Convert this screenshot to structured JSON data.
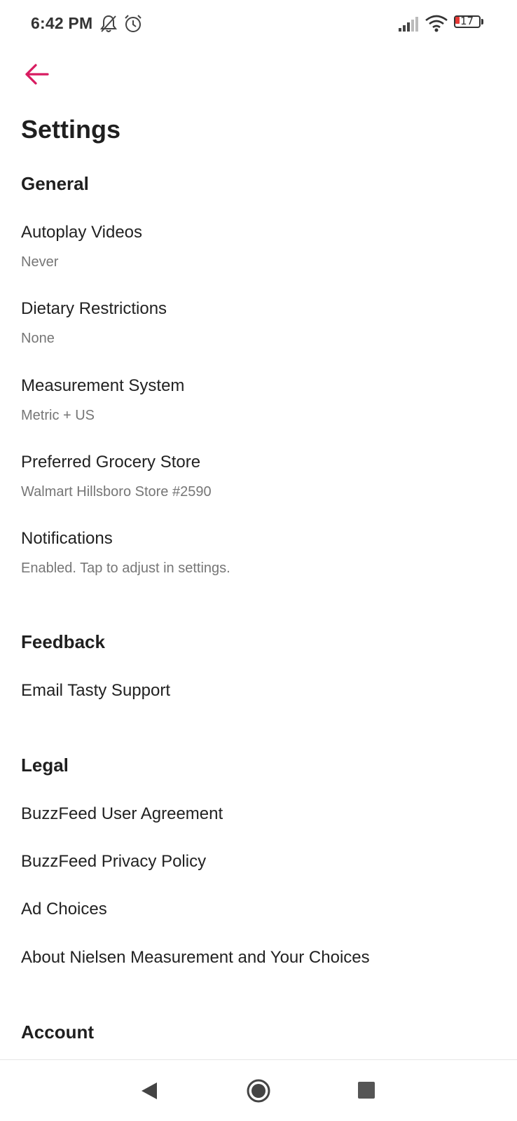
{
  "status_bar": {
    "time": "6:42 PM",
    "battery_level": "17",
    "icons": [
      "bell-muted-icon",
      "alarm-icon",
      "signal-icon",
      "wifi-icon",
      "battery-icon"
    ]
  },
  "header": {
    "back_icon": "arrow-left-icon",
    "title": "Settings"
  },
  "colors": {
    "accent": "#d81b60",
    "battery_low": "#e53935"
  },
  "sections": {
    "general": {
      "title": "General",
      "items": [
        {
          "label": "Autoplay Videos",
          "value": "Never"
        },
        {
          "label": "Dietary Restrictions",
          "value": "None"
        },
        {
          "label": "Measurement System",
          "value": "Metric + US"
        },
        {
          "label": "Preferred Grocery Store",
          "value": "Walmart Hillsboro Store #2590"
        },
        {
          "label": "Notifications",
          "value": "Enabled. Tap to adjust in settings."
        }
      ]
    },
    "feedback": {
      "title": "Feedback",
      "items": [
        {
          "label": "Email Tasty Support"
        }
      ]
    },
    "legal": {
      "title": "Legal",
      "items": [
        {
          "label": "BuzzFeed User Agreement"
        },
        {
          "label": "BuzzFeed Privacy Policy"
        },
        {
          "label": "Ad Choices"
        },
        {
          "label": "About Nielsen Measurement and Your Choices"
        }
      ]
    },
    "account": {
      "title": "Account"
    }
  },
  "nav_bar": {
    "icons": [
      "nav-back-icon",
      "nav-home-icon",
      "nav-recents-icon"
    ]
  }
}
